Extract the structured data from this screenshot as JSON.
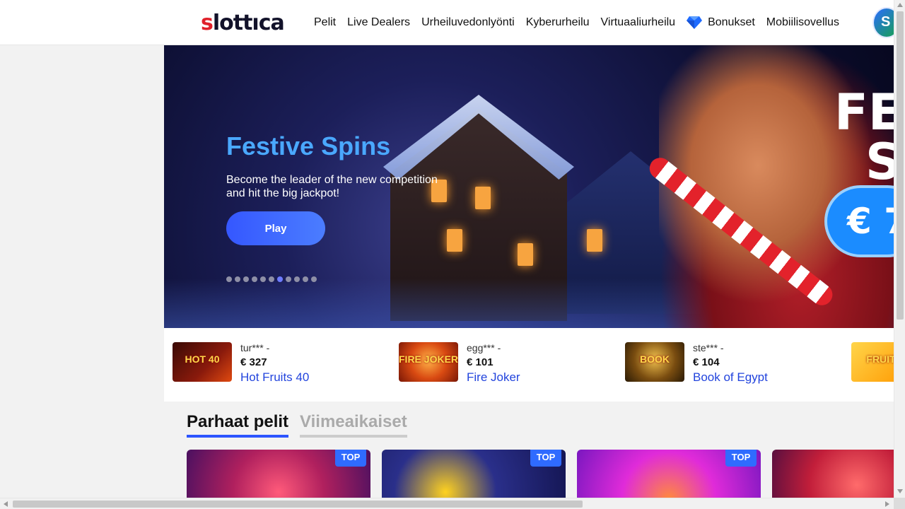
{
  "header": {
    "logo": {
      "first": "s",
      "rest": "lottıca"
    },
    "nav": [
      {
        "label": "Pelit"
      },
      {
        "label": "Live Dealers"
      },
      {
        "label": "Urheiluvedonlyönti"
      },
      {
        "label": "Kyberurheilu"
      },
      {
        "label": "Virtuaaliurheilu"
      },
      {
        "label": "Bonukset",
        "icon": "diamond-icon"
      },
      {
        "label": "Mobiilisovellus"
      }
    ],
    "avatar_initial": "S"
  },
  "banner": {
    "title": "Festive Spins",
    "subtitle": "Become the leader of the new competition and hit the big jackpot!",
    "play_label": "Play",
    "artwork_text_1": "FE",
    "artwork_text_2": "S",
    "artwork_euro": "€ 7",
    "slide_count": 11,
    "active_slide": 7
  },
  "winners": [
    {
      "user": "tur*** -",
      "amount": "€ 327",
      "game": "Hot Fruits 40",
      "thumb_text": "HOT 40",
      "color": "#8a1a0c"
    },
    {
      "user": "egg*** -",
      "amount": "€ 101",
      "game": "Fire Joker",
      "thumb_text": "FIRE JOKER",
      "color": "#b8320e"
    },
    {
      "user": "ste*** -",
      "amount": "€ 104",
      "game": "Book of Egypt",
      "thumb_text": "BOOK",
      "color": "#3b2a0e"
    },
    {
      "user": "",
      "amount": "",
      "game": "",
      "thumb_text": "FRUIT",
      "color": "#ffb300"
    }
  ],
  "tabs": [
    {
      "label": "Parhaat pelit",
      "active": true
    },
    {
      "label": "Viimeaikaiset",
      "active": false
    }
  ],
  "games": [
    {
      "badge": "TOP",
      "color": "#c2185b"
    },
    {
      "badge": "TOP",
      "color": "#1a1f6e"
    },
    {
      "badge": "TOP",
      "color": "#d42be0"
    },
    {
      "badge": "",
      "color": "#c21e3a"
    }
  ],
  "colors": {
    "accent": "#2c55ff",
    "link": "#2244dd",
    "banner_title": "#4aa8ff"
  }
}
